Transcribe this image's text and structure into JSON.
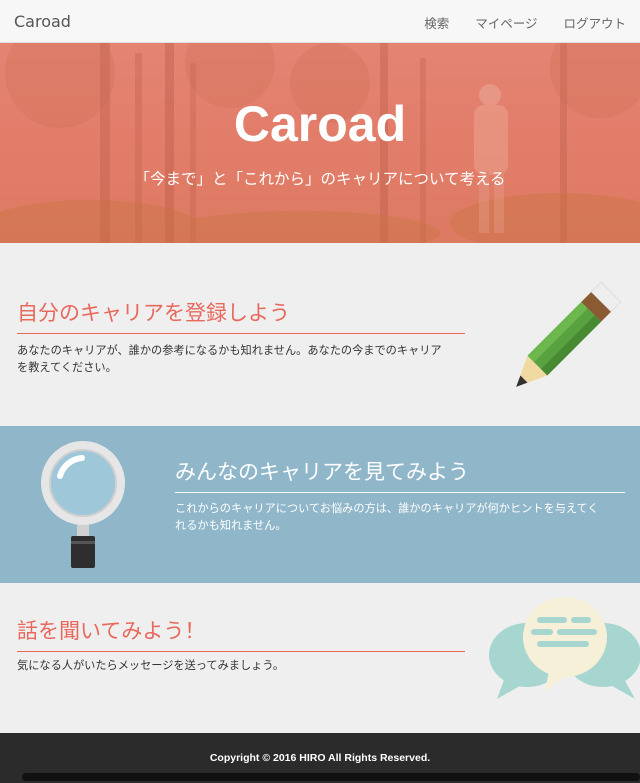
{
  "navbar": {
    "brand": "Caroad",
    "links": [
      "検索",
      "マイページ",
      "ログアウト"
    ]
  },
  "hero": {
    "title": "Caroad",
    "subtitle": "「今まで」と「これから」のキャリアについて考える"
  },
  "sections": [
    {
      "heading": "自分のキャリアを登録しよう",
      "text_lines": [
        "あなたのキャリアが、誰かの参考になるかも知れません。あなたの今までのキャリア",
        "を教えてください。"
      ],
      "icon": "pencil-icon"
    },
    {
      "heading": "みんなのキャリアを見てみよう",
      "text_lines": [
        "これからのキャリアについてお悩みの方は、誰かのキャリアが何かヒントを与えてく",
        "れるかも知れません。"
      ],
      "icon": "magnifier-icon"
    },
    {
      "heading": "話を聞いてみよう！",
      "text_lines": [
        "気になる人がいたらメッセージを送ってみましょう。"
      ],
      "icon": "chat-bubbles-icon"
    }
  ],
  "footer": {
    "copyright": "Copyright © 2016 HIRO All Rights Reserved."
  },
  "colors": {
    "accent": "#e8695c",
    "hero_overlay": "#e27d6a",
    "section_blue": "#8fb6c9",
    "footer": "#2b2b2b"
  }
}
